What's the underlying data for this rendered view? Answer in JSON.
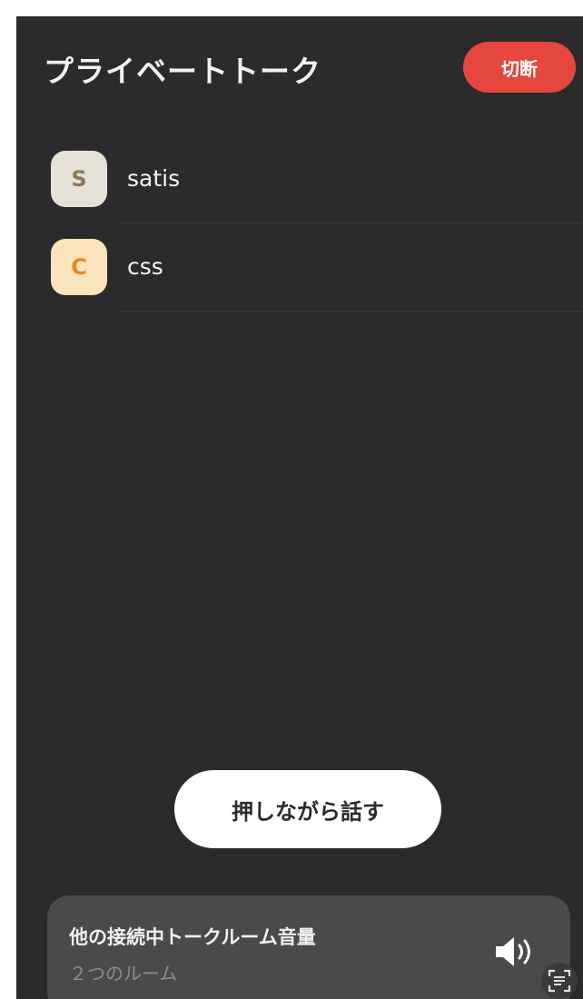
{
  "header": {
    "title": "プライベートトーク",
    "hangup_label": "切断",
    "hangup_color": "#e5473d"
  },
  "members": [
    {
      "initial": "S",
      "name": "satis",
      "avatar_bg": "#e6e1d7",
      "avatar_fg": "#8a7a55"
    },
    {
      "initial": "C",
      "name": "css",
      "avatar_bg": "#fbe3bd",
      "avatar_fg": "#e38a1e"
    }
  ],
  "push_to_talk": {
    "label": "押しながら話す"
  },
  "volume": {
    "title": "他の接続中トークルーム音量",
    "subtitle": "２つのルーム",
    "icon": "speaker-volume-icon"
  },
  "overlay": {
    "icon": "scan-text-icon"
  }
}
